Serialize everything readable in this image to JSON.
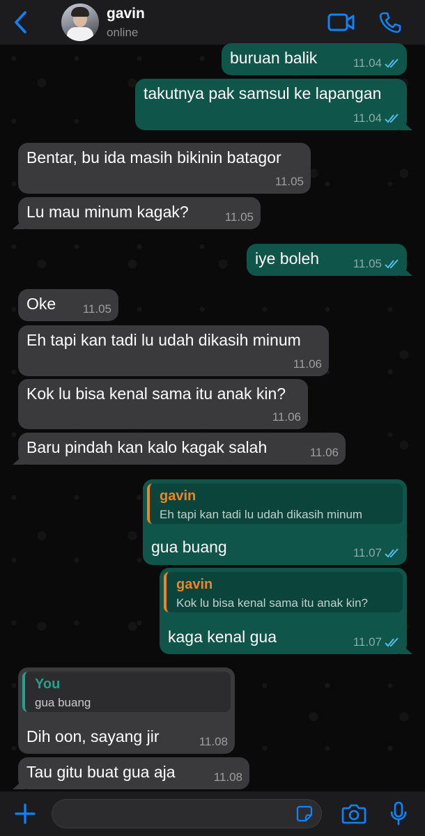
{
  "header": {
    "contact_name": "gavin",
    "status": "online"
  },
  "messages": [
    {
      "dir": "out",
      "text": "buruan balik",
      "time": "11.04",
      "read": true
    },
    {
      "dir": "out",
      "text": "takutnya pak samsul ke lapangan",
      "time": "11.04",
      "read": true
    },
    {
      "dir": "in",
      "text": "Bentar, bu ida masih bikinin batagor",
      "time": "11.05"
    },
    {
      "dir": "in",
      "text": "Lu mau minum kagak?",
      "time": "11.05"
    },
    {
      "dir": "out",
      "text": "iye boleh",
      "time": "11.05",
      "read": true
    },
    {
      "dir": "in",
      "text": "Oke",
      "time": "11.05"
    },
    {
      "dir": "in",
      "text": "Eh tapi kan tadi lu udah dikasih minum",
      "time": "11.06"
    },
    {
      "dir": "in",
      "text": "Kok lu bisa kenal sama itu anak kin?",
      "time": "11.06"
    },
    {
      "dir": "in",
      "text": "Baru pindah kan kalo kagak salah",
      "time": "11.06"
    },
    {
      "dir": "out",
      "text": "gua buang",
      "time": "11.07",
      "read": true,
      "quote": {
        "name": "gavin",
        "text": "Eh tapi kan tadi lu udah dikasih minum"
      }
    },
    {
      "dir": "out",
      "text": "kaga kenal gua",
      "time": "11.07",
      "read": true,
      "quote": {
        "name": "gavin",
        "text": "Kok lu bisa kenal sama itu anak kin?"
      }
    },
    {
      "dir": "in",
      "text": "Dih oon, sayang jir",
      "time": "11.08",
      "quote": {
        "name": "You",
        "text": "gua buang"
      }
    },
    {
      "dir": "in",
      "text": "Tau gitu buat gua aja",
      "time": "11.08"
    }
  ],
  "colors": {
    "accent": "#0a84ff",
    "outgoing_bubble": "#0f5549",
    "incoming_bubble": "#3a3a3c",
    "read_tick": "#53bdeb",
    "quote_self": "#25a08d",
    "quote_other": "#f08322"
  },
  "icons": [
    "back-chevron-icon",
    "video-call-icon",
    "phone-icon",
    "plus-icon",
    "sticker-icon",
    "camera-icon",
    "microphone-icon",
    "double-check-icon"
  ]
}
